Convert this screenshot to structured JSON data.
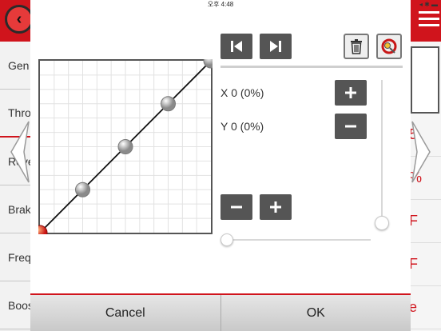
{
  "status_bar": {
    "time": "오후 4:48",
    "right_icons": "◂ ✱ ▬"
  },
  "background": {
    "list_items": [
      "Gen",
      "Thro",
      "Reve",
      "Brak",
      "Freq",
      "Boos"
    ],
    "right_items": [
      "5",
      "%",
      "F",
      "F",
      "e"
    ]
  },
  "curve": {
    "points": [
      [
        0,
        0
      ],
      [
        25,
        25
      ],
      [
        50,
        50
      ],
      [
        75,
        75
      ],
      [
        100,
        100
      ]
    ],
    "selected_point": 0,
    "x_range": [
      0,
      100
    ],
    "y_range": [
      0,
      100
    ]
  },
  "coords": {
    "x_label": "X 0 (0%)",
    "y_label": "Y 0 (0%)"
  },
  "sliders": {
    "vertical_value": 0,
    "horizontal_value": 0
  },
  "footer": {
    "cancel": "Cancel",
    "ok": "OK"
  }
}
